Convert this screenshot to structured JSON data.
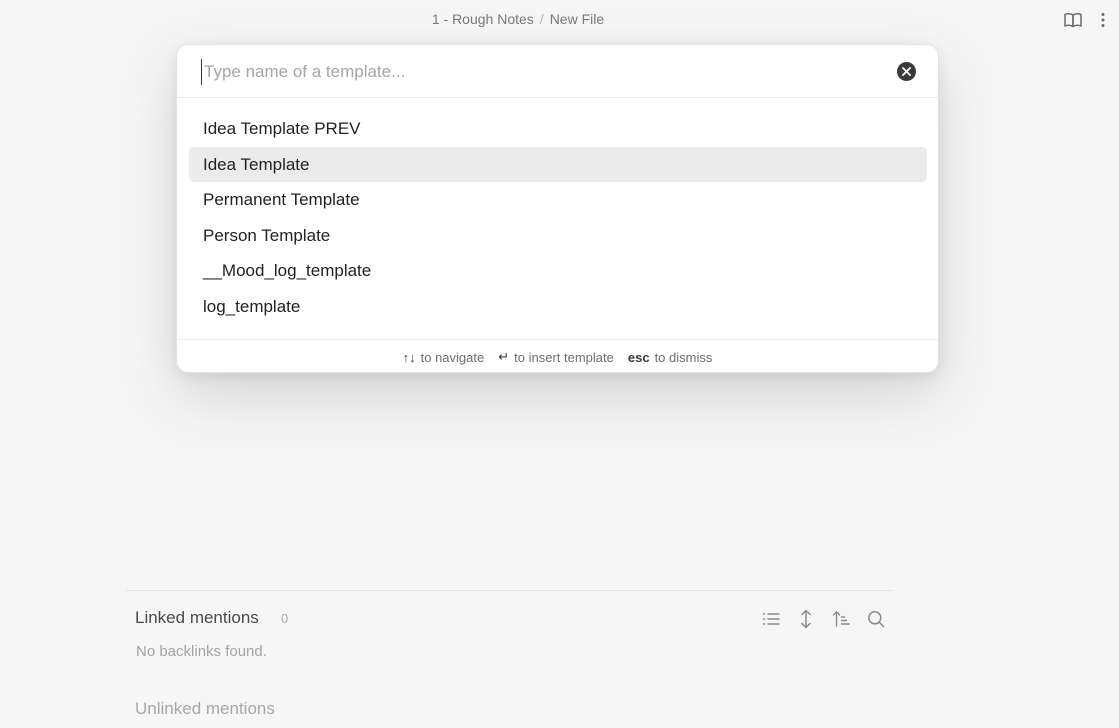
{
  "header": {
    "breadcrumb_folder": "1 - Rough Notes",
    "breadcrumb_separator": "/",
    "breadcrumb_file": "New File"
  },
  "modal": {
    "search": {
      "value": "",
      "placeholder": "Type name of a template..."
    },
    "items": [
      {
        "label": "Idea Template PREV"
      },
      {
        "label": "Idea Template"
      },
      {
        "label": "Permanent Template"
      },
      {
        "label": "Person Template"
      },
      {
        "label": "__Mood_log_template"
      },
      {
        "label": "log_template"
      }
    ],
    "selected_index": 1,
    "footer": {
      "navigate_key": "↑↓",
      "navigate_text": "to navigate",
      "insert_key": "↵",
      "insert_text": "to insert template",
      "dismiss_key": "esc",
      "dismiss_text": "to dismiss"
    }
  },
  "backlinks": {
    "linked_title": "Linked mentions",
    "linked_count": "0",
    "empty_text": "No backlinks found.",
    "unlinked_title": "Unlinked mentions"
  },
  "icons": {
    "top_right": [
      "book-open-icon",
      "more-vertical-icon"
    ],
    "backlink_toolbar": [
      "list-icon",
      "collapse-vertical-icon",
      "sort-icon",
      "search-icon"
    ]
  },
  "colors": {
    "background": "#f6f6f6",
    "modal_bg": "#ffffff",
    "selected_item_bg": "#ebebeb"
  }
}
